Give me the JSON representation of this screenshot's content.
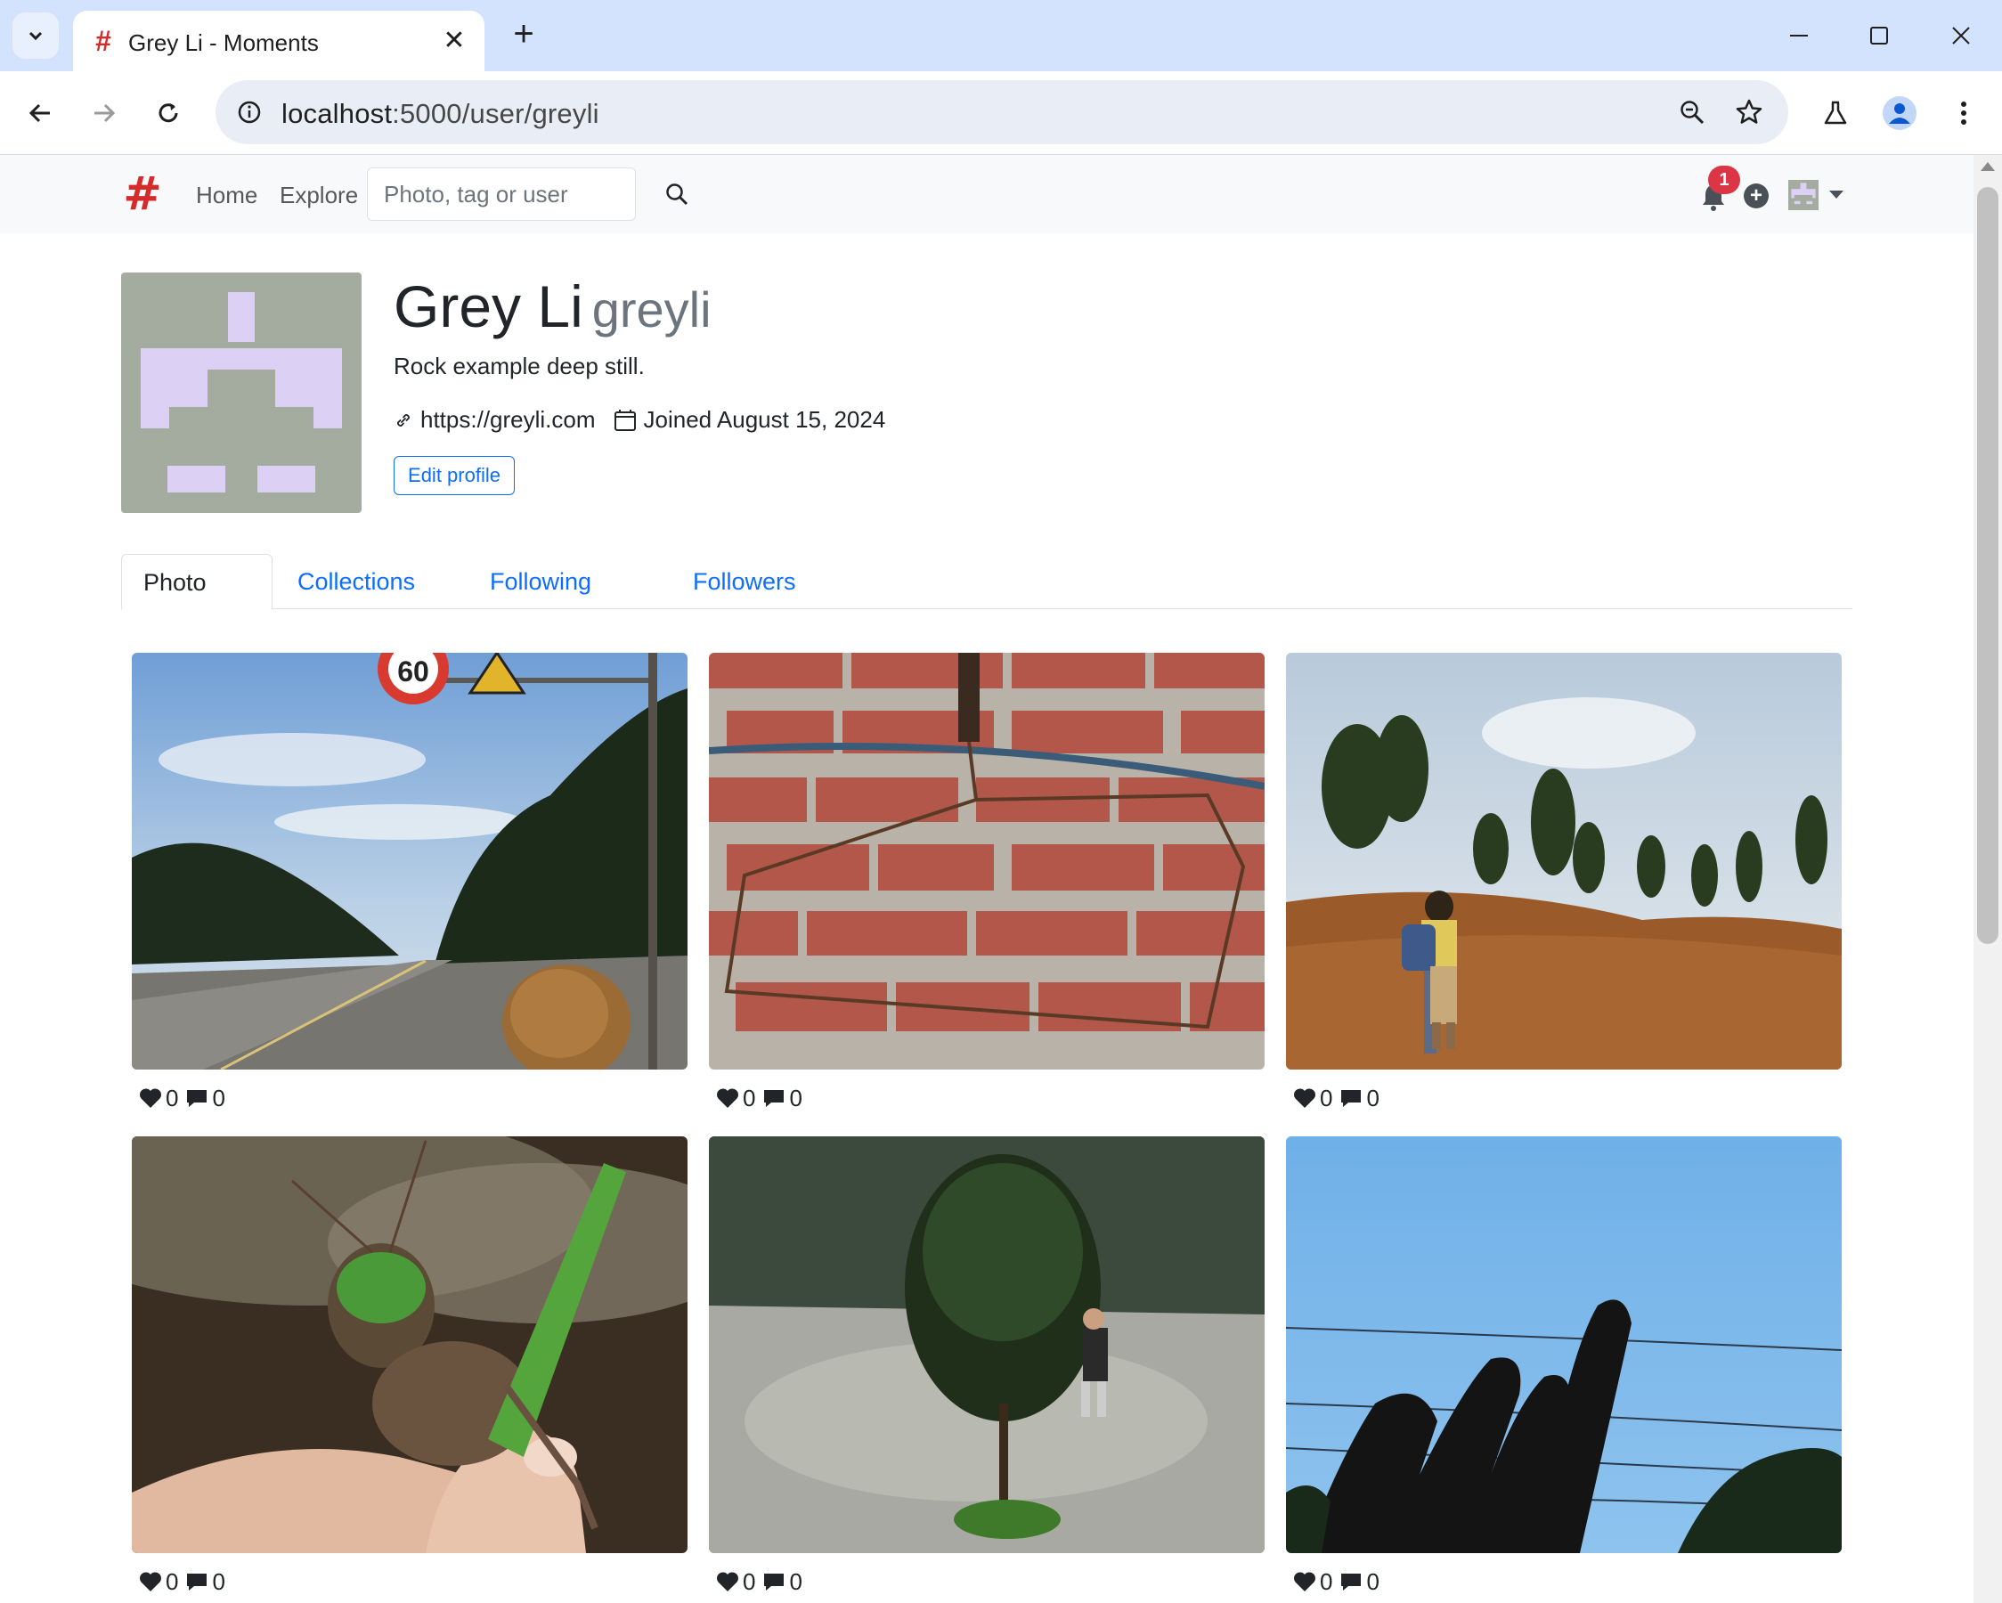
{
  "browser": {
    "tab_title": "Grey Li - Moments",
    "url_host": "localhost",
    "url_path": ":5000/user/greyli"
  },
  "navbar": {
    "home": "Home",
    "explore": "Explore",
    "search_placeholder": "Photo, tag or user",
    "notification_count": "1",
    "plus": "+"
  },
  "profile": {
    "name": "Grey Li",
    "username": "greyli",
    "bio": "Rock example deep still.",
    "website": "https://greyli.com",
    "joined": "Joined August 15, 2024",
    "edit_button": "Edit profile",
    "avatar_colors": {
      "bg": "#a3ac9e",
      "fg": "#dcd0f5"
    }
  },
  "tabs": [
    "Photo",
    "Collections",
    "Following",
    "Followers"
  ],
  "photos": [
    {
      "subject": "road with speed limit 60 sign",
      "sign_text": "60",
      "likes": "0",
      "comments": "0"
    },
    {
      "subject": "wire hanger on brick wall",
      "likes": "0",
      "comments": "0"
    },
    {
      "subject": "child with backpack on hill",
      "likes": "0",
      "comments": "0"
    },
    {
      "subject": "grasshopper on fingers",
      "likes": "0",
      "comments": "0"
    },
    {
      "subject": "small tree in rainy yard",
      "likes": "0",
      "comments": "0"
    },
    {
      "subject": "hand silhouette against blue sky",
      "likes": "0",
      "comments": "0"
    }
  ],
  "colors": {
    "brand": "#d62b2b",
    "link": "#0d6efd",
    "badge": "#dc3545"
  }
}
